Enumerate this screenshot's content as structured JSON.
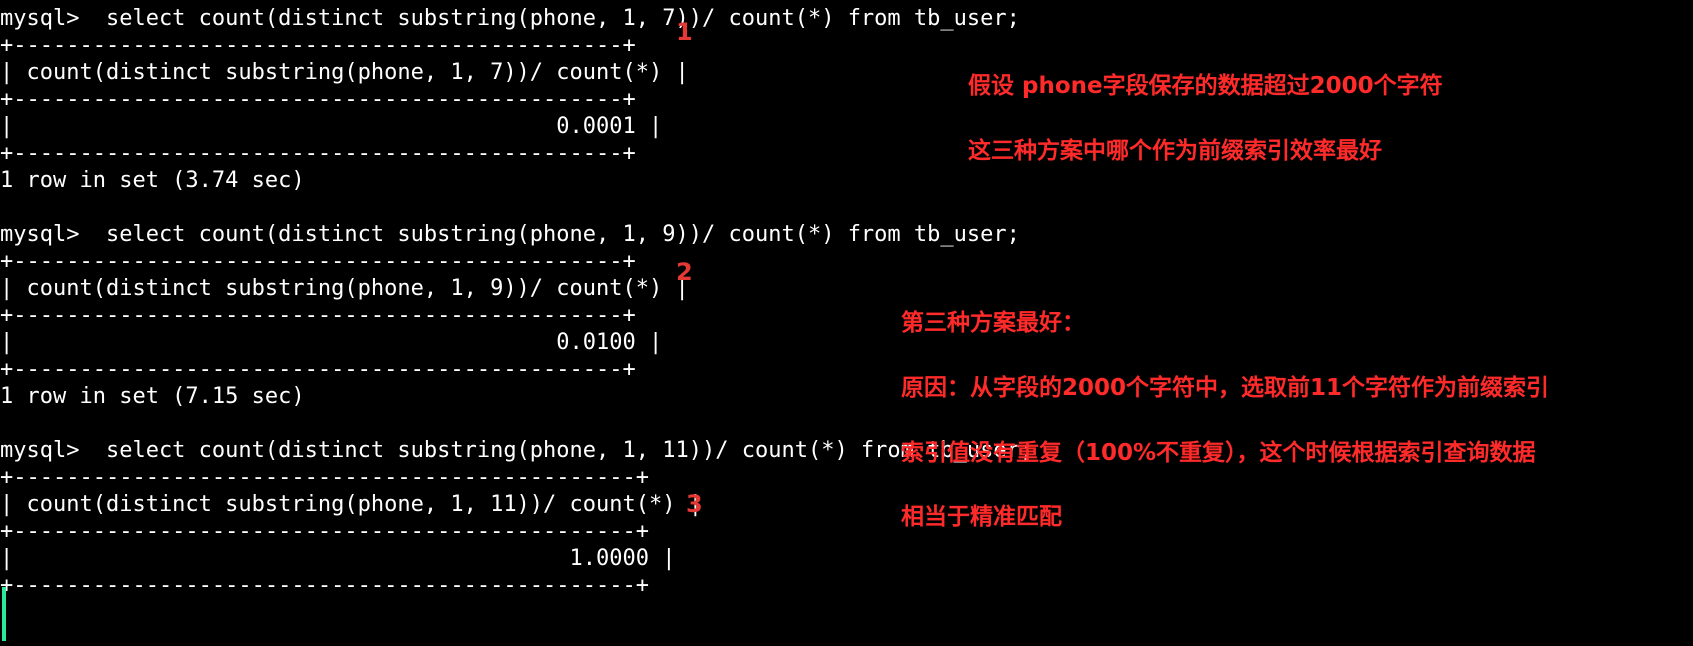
{
  "terminal": {
    "colors": {
      "background": "#000000",
      "text": "#ffffff",
      "annotation": "#ff2a2a",
      "cursor": "#2ee89a"
    },
    "query1": {
      "command": "mysql>  select count(distinct substring(phone, 1, 7))/ count(*) from tb_user;",
      "border_top": "+----------------------------------------------+",
      "header": "| count(distinct substring(phone, 1, 7))/ count(*) |",
      "border_mid": "+----------------------------------------------+",
      "value_row": "|                                         0.0001 |",
      "border_bottom": "+----------------------------------------------+",
      "footer": "1 row in set (3.74 sec)"
    },
    "query2": {
      "command": "mysql>  select count(distinct substring(phone, 1, 9))/ count(*) from tb_user;",
      "border_top": "+----------------------------------------------+",
      "header": "| count(distinct substring(phone, 1, 9))/ count(*) |",
      "border_mid": "+----------------------------------------------+",
      "value_row": "|                                         0.0100 |",
      "border_bottom": "+----------------------------------------------+",
      "footer": "1 row in set (7.15 sec)"
    },
    "query3": {
      "command": "mysql>  select count(distinct substring(phone, 1, 11))/ count(*) from tb_user;",
      "border_top": "+-----------------------------------------------+",
      "header": "| count(distinct substring(phone, 1, 11))/ count(*) |",
      "border_mid": "+-----------------------------------------------+",
      "value_row": "|                                          1.0000 |",
      "border_bottom": "+-----------------------------------------------+"
    }
  },
  "markers": {
    "m1": "1",
    "m2": "2",
    "m3": "3"
  },
  "annotations": {
    "question_line1": "假设 phone字段保存的数据超过2000个字符",
    "question_line2": "这三种方案中哪个作为前缀索引效率最好",
    "answer_title": "第三种方案最好：",
    "answer_reason1": "原因：从字段的2000个字符中，选取前11个字符作为前缀索引",
    "answer_reason2": "索引值没有重复（100%不重复），这个时候根据索引查询数据",
    "answer_reason3": "相当于精准匹配"
  }
}
